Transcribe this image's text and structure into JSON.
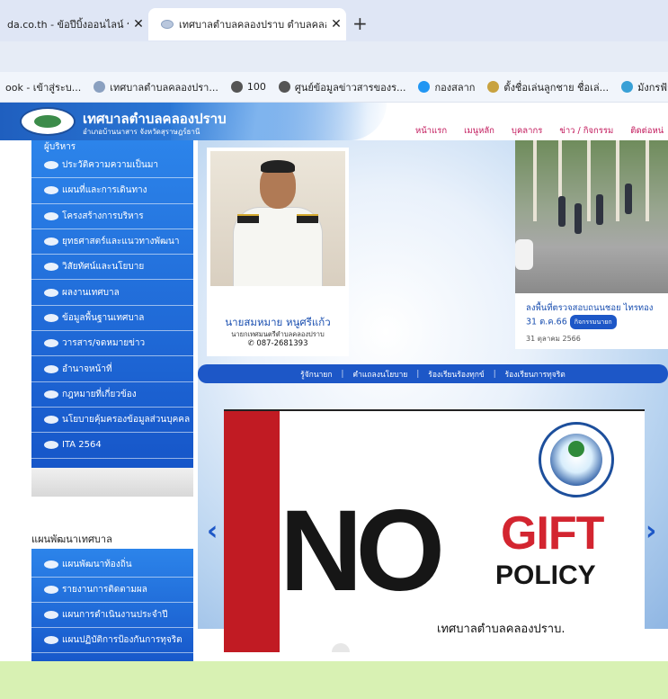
{
  "browser": {
    "tabs": [
      {
        "title": "da.co.th - ข้อปีบิ้งออนไลน์ รับ..."
      },
      {
        "title": "เทศบาลตำบลคลองปราบ ตำบลคลอง..."
      }
    ],
    "new_tab": "+",
    "close": "✕",
    "bookmarks": [
      {
        "label": "ook - เข้าสู่ระบ...",
        "color": "#1877f2"
      },
      {
        "label": "เทศบาลตำบลคลองปรา...",
        "color": "#8aa0c0"
      },
      {
        "label": "100",
        "color": "#555555"
      },
      {
        "label": "ศูนย์ข้อมูลข่าวสารของร...",
        "color": "#555555"
      },
      {
        "label": "กองสลาก",
        "color": "#2196f3"
      },
      {
        "label": "ตั้งชื่อเล่นลูกชาย ชื่อเล่...",
        "color": "#c8a240"
      },
      {
        "label": "มังกรฟ้า ล็อตเตอรี่ ออน...",
        "color": "#39a0d6"
      }
    ]
  },
  "site": {
    "title": "เทศบาลตำบลคลองปราบ",
    "subtitle": "อำเภอบ้านนาสาร จังหวัดสุราษฎร์ธานี",
    "nav": [
      "หน้าแรก",
      "เมนูหลัก",
      "บุคลากร",
      "ข่าว / กิจกรรม",
      "ติดต่อหน่"
    ],
    "menu_top": "ผู้บริหาร",
    "menu": [
      "ประวัติความความเป็นมา",
      "แผนที่และการเดินทาง",
      "โครงสร้างการบริหาร",
      "ยุทธศาสตร์และแนวทางพัฒนา",
      "วิสัยทัศน์และนโยบาย",
      "ผลงานเทศบาล",
      "ข้อมูลพื้นฐานเทศบาล",
      "วารสาร/จดหมายข่าว",
      "อำนาจหน้าที่",
      "กฎหมายที่เกี่ยวข้อง",
      "นโยบายคุ้มครองข้อมูลส่วนบุคคล",
      "ITA 2564"
    ],
    "plan_title": "แผนพัฒนาเทศบาล",
    "plan_menu": [
      "แผนพัฒนาท้องถิ่น",
      "รายงานการติดตามผล",
      "แผนการดำเนินงานประจำปี",
      "แผนปฏิบัติการป้องกันการทุจริต"
    ],
    "profile": {
      "name": "นายสมหมาย หนูศรีแก้ว",
      "role": "นายกเทศมนตรีตำบลคลองปราบ",
      "phone": "087-2681393"
    },
    "news": {
      "title": "ลงพื้นที่ตรวจสอบถนนชอย ไทรทอง 31 ต.ค.66",
      "tag": "กิจกรรมนายก",
      "date": "31 ตุลาคม 2566"
    },
    "links": [
      "รู้จักนายก",
      "คำแถลงนโยบาย",
      "ร้องเรียนร้องทุกข์",
      "ร้องเรียนการทุจริต"
    ],
    "slide": {
      "no": "NO",
      "gift": "GIFT",
      "policy": "POLICY",
      "caption": "เทศบาลตำบลคลองปราบ."
    },
    "arrows": {
      "prev": "‹",
      "next": "›"
    }
  }
}
